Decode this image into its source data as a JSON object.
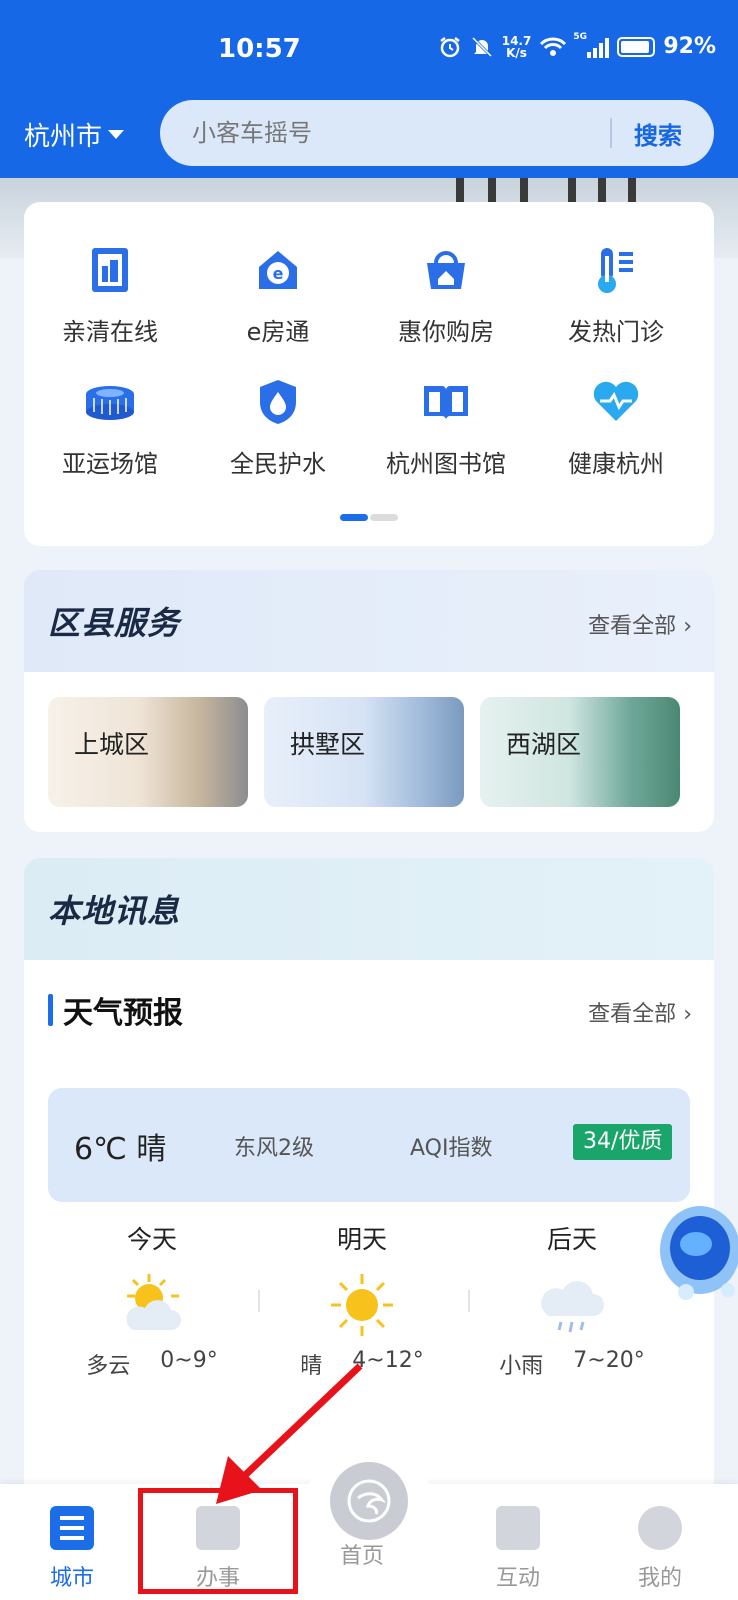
{
  "status_bar": {
    "time": "10:57",
    "net_speed_value": "14.7",
    "net_speed_unit": "K/s",
    "signal_label": "5G",
    "battery": "92%"
  },
  "header": {
    "city": "杭州市",
    "search_placeholder": "小客车摇号",
    "search_button": "搜索",
    "accent_color": "#1668e6"
  },
  "apps": [
    {
      "label": "亲清在线",
      "icon": "building-doc-icon"
    },
    {
      "label": "e房通",
      "icon": "house-e-icon"
    },
    {
      "label": "惠你购房",
      "icon": "basket-house-icon"
    },
    {
      "label": "发热门诊",
      "icon": "thermometer-icon"
    },
    {
      "label": "亚运场馆",
      "icon": "stadium-icon"
    },
    {
      "label": "全民护水",
      "icon": "water-shield-icon"
    },
    {
      "label": "杭州图书馆",
      "icon": "book-icon"
    },
    {
      "label": "健康杭州",
      "icon": "heart-pulse-icon"
    }
  ],
  "district_services": {
    "title": "区县服务",
    "view_all": "查看全部",
    "districts": [
      "上城区",
      "拱墅区",
      "西湖区"
    ]
  },
  "local_news": {
    "title": "本地讯息",
    "weather_title": "天气预报",
    "view_all": "查看全部",
    "current": {
      "temperature": "6℃ 晴",
      "wind": "东风2级",
      "aqi_label": "AQI指数",
      "aqi_value": "34/优质",
      "aqi_color": "#1aa56b"
    },
    "forecast": [
      {
        "day": "今天",
        "condition": "多云",
        "range": "0~9°",
        "icon": "partly-cloudy-icon"
      },
      {
        "day": "明天",
        "condition": "晴",
        "range": "4~12°",
        "icon": "sunny-icon"
      },
      {
        "day": "后天",
        "condition": "小雨",
        "range": "7~20°",
        "icon": "light-rain-icon"
      }
    ]
  },
  "tabbar": {
    "tabs": [
      {
        "label": "城市",
        "active": true
      },
      {
        "label": "办事",
        "active": false
      },
      {
        "label": "首页",
        "active": false
      },
      {
        "label": "互动",
        "active": false
      },
      {
        "label": "我的",
        "active": false
      }
    ]
  },
  "annotation": {
    "highlight_color": "#e8121b"
  }
}
